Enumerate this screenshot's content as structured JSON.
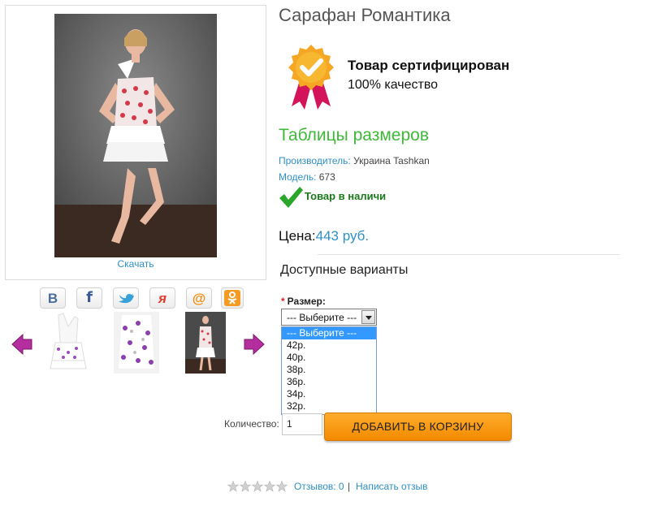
{
  "product": {
    "title": "Сарафан Романтика",
    "download_label": "Скачать"
  },
  "certificate": {
    "title": "Товар сертифицирован",
    "subtitle": "100% качество"
  },
  "size_tables_link": "Таблицы размеров",
  "details": {
    "manufacturer_label": "Производитель:",
    "manufacturer_value": " Украина Tashkan",
    "model_label": "Модель:",
    "model_value": " 673"
  },
  "stock_status": "Товар в наличи",
  "price": {
    "label": "Цена:",
    "value": "443 руб."
  },
  "variants_title": "Доступные варианты",
  "size": {
    "required_mark": "*",
    "label": "Размер:",
    "selected": "--- Выберите ---",
    "options": [
      "--- Выберите ---",
      "42р.",
      "40р.",
      "38р.",
      "36р.",
      "34р.",
      "32р."
    ]
  },
  "quantity": {
    "label": "Количество:",
    "value": "1"
  },
  "cart_button_label": "ДОБАВИТЬ В КОРЗИНУ",
  "reviews": {
    "count_label": "Отзывов: 0",
    "separator": "|",
    "write_label": "Написать отзыв"
  },
  "share_icons": [
    "vk-icon",
    "facebook-icon",
    "twitter-icon",
    "yaru-icon",
    "mailru-icon",
    "odnoklassniki-icon"
  ],
  "colors": {
    "accent_link": "#2f8fc4",
    "size_tables_green": "#3fb83a",
    "in_stock_green": "#1b7a1b",
    "cart_orange": "#f39200",
    "dropdown_highlight": "#3399ff"
  }
}
